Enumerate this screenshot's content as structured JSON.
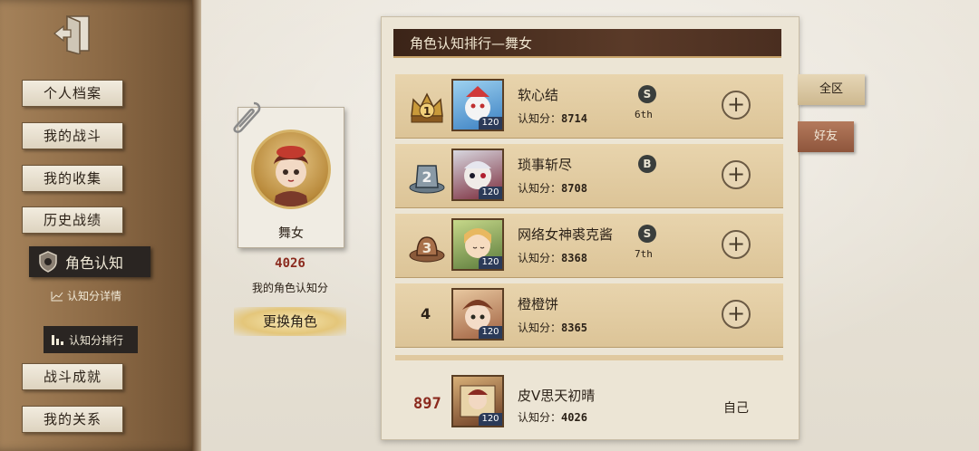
{
  "sidebar": {
    "items": [
      {
        "label": "个人档案"
      },
      {
        "label": "我的战斗"
      },
      {
        "label": "我的收集"
      },
      {
        "label": "历史战绩"
      },
      {
        "label": "战斗成就"
      },
      {
        "label": "我的关系"
      }
    ],
    "active": {
      "label": "角色认知"
    },
    "sub_items": [
      {
        "label": "认知分详情"
      },
      {
        "label": "认知分排行"
      }
    ]
  },
  "character": {
    "name": "舞女",
    "score": "4026",
    "score_label": "我的角色认知分",
    "change_button": "更换角色"
  },
  "panel": {
    "title": "角色认知排行—舞女",
    "score_prefix": "认知分：",
    "rows": [
      {
        "rank": "1",
        "name": "软心结",
        "score": "8714",
        "level": "120",
        "tier_icon": "S",
        "tier_rank": "6th"
      },
      {
        "rank": "2",
        "name": "琐事斩尽",
        "score": "8708",
        "level": "120",
        "tier_icon": "B",
        "tier_rank": ""
      },
      {
        "rank": "3",
        "name": "网络女神裘克酱",
        "score": "8368",
        "level": "120",
        "tier_icon": "S",
        "tier_rank": "7th"
      },
      {
        "rank": "4",
        "name": "橙橙饼",
        "score": "8365",
        "level": "120",
        "tier_icon": "",
        "tier_rank": ""
      }
    ],
    "self": {
      "rank": "897",
      "name": "皮V思天初晴",
      "score": "4026",
      "level": "120",
      "tag": "自己"
    }
  },
  "tabs": {
    "all": "全区",
    "friends": "好友"
  },
  "colors": {
    "accent": "#8b2a1e",
    "title_bar": "#3b2418",
    "row_bg": "#e8d4ad"
  }
}
